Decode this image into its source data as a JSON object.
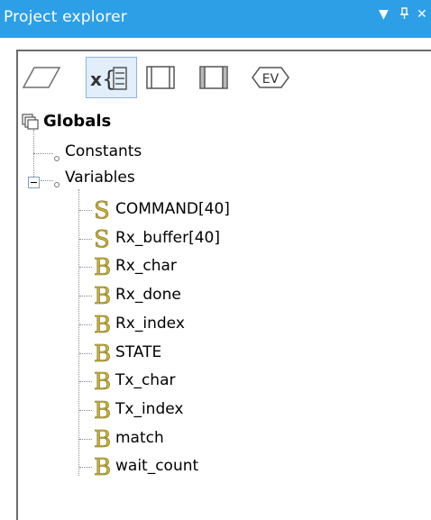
{
  "window": {
    "title": "Project explorer",
    "buttons": [
      "▼",
      "ᵖ",
      "✕"
    ]
  },
  "toolbar": {
    "buttons": [
      {
        "name": "flowchart-view-icon"
      },
      {
        "name": "variables-view-icon",
        "selected": true
      },
      {
        "name": "macro-view-icon"
      },
      {
        "name": "component-macro-view-icon"
      },
      {
        "name": "events-view-icon",
        "label": "EV"
      }
    ]
  },
  "tree": {
    "root": {
      "label": "Globals"
    },
    "constants": {
      "label": "Constants"
    },
    "variables": {
      "label": "Variables",
      "expander": "−",
      "items": [
        {
          "type": "S",
          "label": "COMMAND[40]"
        },
        {
          "type": "S",
          "label": "Rx_buffer[40]"
        },
        {
          "type": "B",
          "label": "Rx_char"
        },
        {
          "type": "B",
          "label": "Rx_done"
        },
        {
          "type": "B",
          "label": "Rx_index"
        },
        {
          "type": "B",
          "label": "STATE"
        },
        {
          "type": "B",
          "label": "Tx_char"
        },
        {
          "type": "B",
          "label": "Tx_index"
        },
        {
          "type": "B",
          "label": "match"
        },
        {
          "type": "B",
          "label": "wait_count"
        }
      ]
    }
  },
  "colors": {
    "titlebar": "#2d9fe7",
    "string_icon": "#c8b23a",
    "byte_icon": "#c8b23a"
  }
}
